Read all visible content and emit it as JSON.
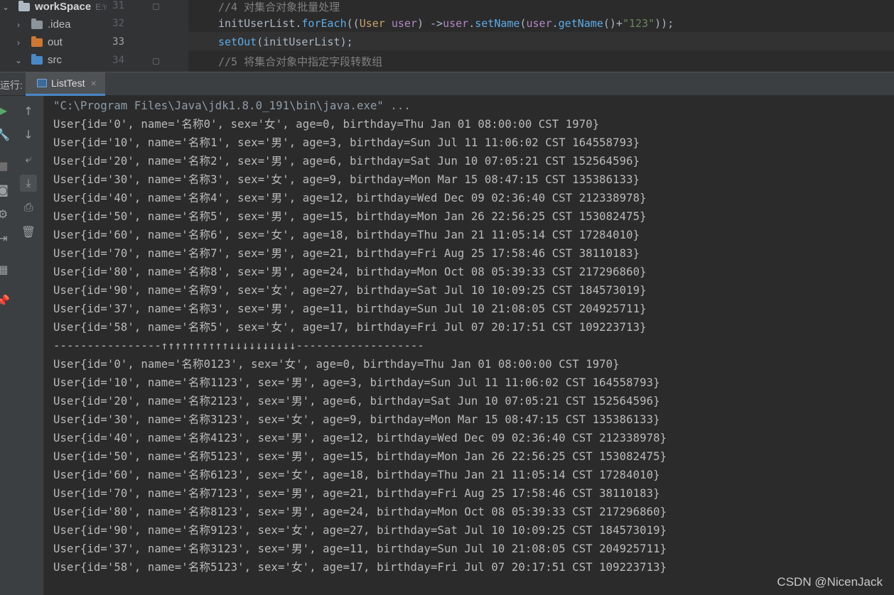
{
  "project_tree": {
    "root_label": "workSpace",
    "root_path": "E:\\w",
    "items": [
      {
        "label": "workSpace",
        "color": "#aeb9c3",
        "expanded": true
      },
      {
        "label": ".idea",
        "color": "#8c949b",
        "expanded": false
      },
      {
        "label": "out",
        "color": "#cc7832",
        "expanded": false
      },
      {
        "label": "src",
        "color": "#4a88c7",
        "expanded": true
      }
    ]
  },
  "editor": {
    "line_numbers": [
      "31",
      "32",
      "33",
      "34"
    ],
    "lines": [
      {
        "segments": [
          {
            "t": "//4 对集合对象批量处理",
            "c": "cm"
          }
        ]
      },
      {
        "segments": [
          {
            "t": "initUserList.",
            "c": ""
          },
          {
            "t": "forEach",
            "c": "mth"
          },
          {
            "t": "((",
            "c": ""
          },
          {
            "t": "User ",
            "c": "typ"
          },
          {
            "t": "user",
            "c": "prm"
          },
          {
            "t": ") ->",
            "c": ""
          },
          {
            "t": "user",
            "c": "prm"
          },
          {
            "t": ".",
            "c": ""
          },
          {
            "t": "setName",
            "c": "mth"
          },
          {
            "t": "(",
            "c": ""
          },
          {
            "t": "user",
            "c": "prm"
          },
          {
            "t": ".",
            "c": ""
          },
          {
            "t": "getName",
            "c": "mth"
          },
          {
            "t": "()+",
            "c": ""
          },
          {
            "t": "\"123\"",
            "c": "str"
          },
          {
            "t": "));",
            "c": ""
          }
        ]
      },
      {
        "segments": [
          {
            "t": "setOut",
            "c": "mth"
          },
          {
            "t": "(initUserList);",
            "c": ""
          }
        ]
      },
      {
        "segments": [
          {
            "t": "//5 将集合对象中指定字段转数组",
            "c": "cm"
          }
        ]
      }
    ]
  },
  "run_panel": {
    "label": "运行:",
    "tab_label": "ListTest",
    "close_glyph": "×"
  },
  "toolbar_icons": [
    {
      "name": "rerun-icon",
      "glyph": "▶",
      "color": "#59a869"
    },
    {
      "name": "up-arrow-icon",
      "glyph": "↑",
      "color": "#9da0a2"
    },
    {
      "name": "wrench-icon",
      "glyph": "🔧",
      "color": "#9da0a2"
    },
    {
      "name": "down-arrow-icon",
      "glyph": "↓",
      "color": "#9da0a2"
    },
    {
      "name": "stop-icon",
      "glyph": "■",
      "color": "#6e6e6e"
    },
    {
      "name": "soft-wrap-icon",
      "glyph": "⤶",
      "color": "#9da0a2"
    },
    {
      "name": "camera-icon",
      "glyph": "◙",
      "color": "#9da0a2"
    },
    {
      "name": "scroll-to-end-icon",
      "glyph": "⤓",
      "color": "#9da0a2"
    },
    {
      "name": "settings-icon",
      "glyph": "⚙",
      "color": "#9da0a2"
    },
    {
      "name": "print-icon",
      "glyph": "⎙",
      "color": "#9da0a2"
    },
    {
      "name": "exit-icon",
      "glyph": "⇥",
      "color": "#9da0a2"
    },
    {
      "name": "trash-icon",
      "glyph": "🗑",
      "color": "#9da0a2"
    },
    {
      "name": "layout-icon",
      "glyph": "▦",
      "color": "#9da0a2"
    },
    {
      "name": "pin-icon",
      "glyph": "📌",
      "color": "#9da0a2"
    }
  ],
  "console": {
    "lines": [
      "\"C:\\Program Files\\Java\\jdk1.8.0_191\\bin\\java.exe\" ...",
      "User{id='0', name='名称0', sex='女', age=0, birthday=Thu Jan 01 08:00:00 CST 1970}",
      "User{id='10', name='名称1', sex='男', age=3, birthday=Sun Jul 11 11:06:02 CST 164558793}",
      "User{id='20', name='名称2', sex='男', age=6, birthday=Sat Jun 10 07:05:21 CST 152564596}",
      "User{id='30', name='名称3', sex='女', age=9, birthday=Mon Mar 15 08:47:15 CST 135386133}",
      "User{id='40', name='名称4', sex='男', age=12, birthday=Wed Dec 09 02:36:40 CST 212338978}",
      "User{id='50', name='名称5', sex='男', age=15, birthday=Mon Jan 26 22:56:25 CST 153082475}",
      "User{id='60', name='名称6', sex='女', age=18, birthday=Thu Jan 21 11:05:14 CST 17284010}",
      "User{id='70', name='名称7', sex='男', age=21, birthday=Fri Aug 25 17:58:46 CST 38110183}",
      "User{id='80', name='名称8', sex='男', age=24, birthday=Mon Oct 08 05:39:33 CST 217296860}",
      "User{id='90', name='名称9', sex='女', age=27, birthday=Sat Jul 10 10:09:25 CST 184573019}",
      "User{id='37', name='名称3', sex='男', age=11, birthday=Sun Jul 10 21:08:05 CST 204925711}",
      "User{id='58', name='名称5', sex='女', age=17, birthday=Fri Jul 07 20:17:51 CST 109223713}",
      "----------------↑↑↑↑↑↑↑↑↑↑↓↓↓↓↓↓↓↓↓↓-------------------",
      "User{id='0', name='名称0123', sex='女', age=0, birthday=Thu Jan 01 08:00:00 CST 1970}",
      "User{id='10', name='名称1123', sex='男', age=3, birthday=Sun Jul 11 11:06:02 CST 164558793}",
      "User{id='20', name='名称2123', sex='男', age=6, birthday=Sat Jun 10 07:05:21 CST 152564596}",
      "User{id='30', name='名称3123', sex='女', age=9, birthday=Mon Mar 15 08:47:15 CST 135386133}",
      "User{id='40', name='名称4123', sex='男', age=12, birthday=Wed Dec 09 02:36:40 CST 212338978}",
      "User{id='50', name='名称5123', sex='男', age=15, birthday=Mon Jan 26 22:56:25 CST 153082475}",
      "User{id='60', name='名称6123', sex='女', age=18, birthday=Thu Jan 21 11:05:14 CST 17284010}",
      "User{id='70', name='名称7123', sex='男', age=21, birthday=Fri Aug 25 17:58:46 CST 38110183}",
      "User{id='80', name='名称8123', sex='男', age=24, birthday=Mon Oct 08 05:39:33 CST 217296860}",
      "User{id='90', name='名称9123', sex='女', age=27, birthday=Sat Jul 10 10:09:25 CST 184573019}",
      "User{id='37', name='名称3123', sex='男', age=11, birthday=Sun Jul 10 21:08:05 CST 204925711}",
      "User{id='58', name='名称5123', sex='女', age=17, birthday=Fri Jul 07 20:17:51 CST 109223713}"
    ]
  },
  "watermark": "CSDN @NicenJack"
}
